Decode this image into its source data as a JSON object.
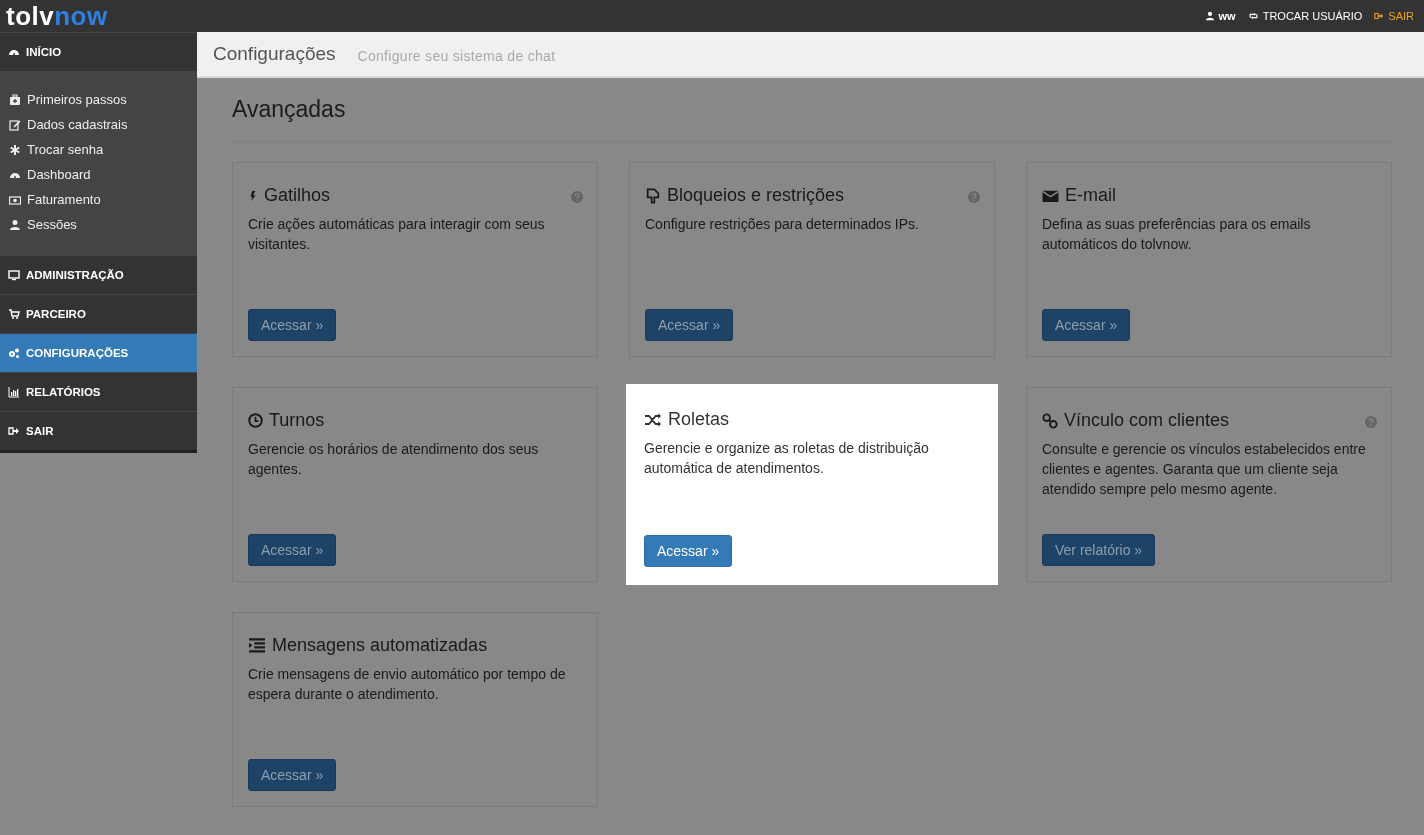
{
  "topbar": {
    "logo_a": "tolv",
    "logo_b": "now",
    "user": "ww",
    "switch_user": "TROCAR USUÁRIO",
    "logout": "SAIR"
  },
  "sidebar": {
    "items": [
      {
        "label": "INÍCIO",
        "selected": false,
        "children": [
          {
            "label": "Primeiros passos"
          },
          {
            "label": "Dados cadastrais"
          },
          {
            "label": "Trocar senha"
          },
          {
            "label": "Dashboard"
          },
          {
            "label": "Faturamento"
          },
          {
            "label": "Sessões"
          }
        ]
      },
      {
        "label": "ADMINISTRAÇÃO",
        "selected": false
      },
      {
        "label": "PARCEIRO",
        "selected": false
      },
      {
        "label": "CONFIGURAÇÕES",
        "selected": true
      },
      {
        "label": "RELATÓRIOS",
        "selected": false
      },
      {
        "label": "SAIR",
        "selected": false
      }
    ]
  },
  "header": {
    "title": "Configurações",
    "subtitle": "Configure seu sistema de chat"
  },
  "section_title": "Avançadas",
  "cards": [
    {
      "title": "Gatilhos",
      "description": "Crie ações automáticas para interagir com seus visitantes.",
      "button": "Acessar »",
      "help": true,
      "highlighted": false
    },
    {
      "title": "Bloqueios e restrições",
      "description": "Configure restrições para determinados IPs.",
      "button": "Acessar »",
      "help": true,
      "highlighted": false
    },
    {
      "title": "E-mail",
      "description": "Defina as suas preferências para os emails automáticos do tolvnow.",
      "button": "Acessar »",
      "help": false,
      "highlighted": false
    },
    {
      "title": "Turnos",
      "description": "Gerencie os horários de atendimento dos seus agentes.",
      "button": "Acessar »",
      "help": false,
      "highlighted": false
    },
    {
      "title": "Roletas",
      "description": "Gerencie e organize as roletas de distribuição automática de atendimentos.",
      "button": "Acessar »",
      "help": false,
      "highlighted": true
    },
    {
      "title": "Vínculo com clientes",
      "description": "Consulte e gerencie os vínculos estabelecidos entre clientes e agentes. Garanta que um cliente seja atendido sempre pelo mesmo agente.",
      "button": "Ver relatório »",
      "help": true,
      "highlighted": false
    },
    {
      "title": "Mensagens automatizadas",
      "description": "Crie mensagens de envio automático por tempo de espera durante o atendimento.",
      "button": "Acessar »",
      "help": false,
      "highlighted": false
    }
  ]
}
